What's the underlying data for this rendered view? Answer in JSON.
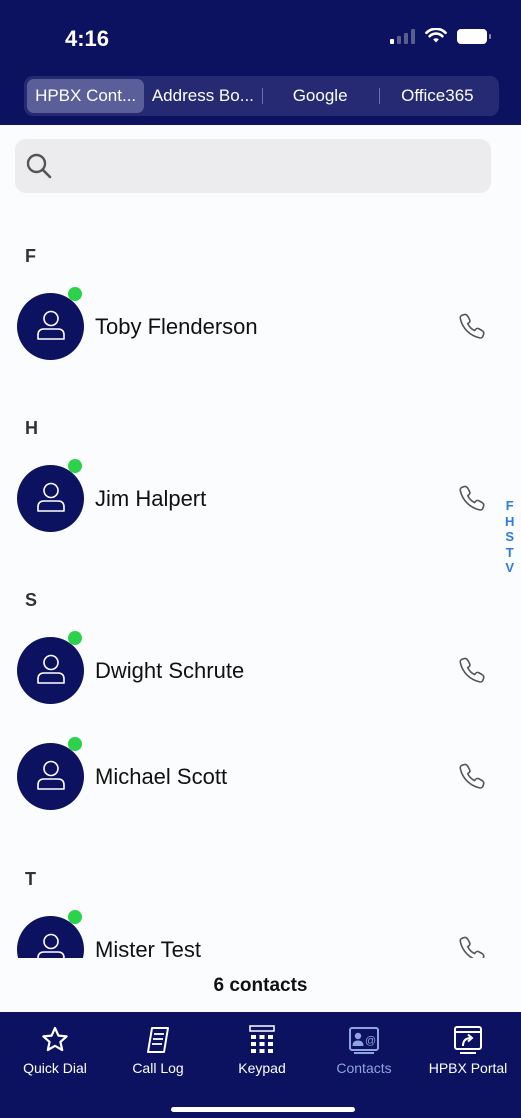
{
  "status_bar": {
    "time": "4:16"
  },
  "source_tabs": [
    {
      "label": "HPBX Cont...",
      "active": true
    },
    {
      "label": "Address Bo...",
      "active": false
    },
    {
      "label": "Google",
      "active": false
    },
    {
      "label": "Office365",
      "active": false
    }
  ],
  "search": {
    "placeholder": "",
    "value": "",
    "icon": "search-icon"
  },
  "sections": [
    {
      "letter": "F",
      "contacts": [
        {
          "name": "Toby Flenderson",
          "online": true
        }
      ]
    },
    {
      "letter": "H",
      "contacts": [
        {
          "name": "Jim Halpert",
          "online": true
        }
      ]
    },
    {
      "letter": "S",
      "contacts": [
        {
          "name": "Dwight Schrute",
          "online": true
        },
        {
          "name": "Michael Scott",
          "online": true
        }
      ]
    },
    {
      "letter": "T",
      "contacts": [
        {
          "name": "Mister Test",
          "online": true
        }
      ]
    }
  ],
  "index_letters": [
    "F",
    "H",
    "S",
    "T",
    "V"
  ],
  "contact_count": "6 contacts",
  "tab_bar": [
    {
      "label": "Quick Dial",
      "icon": "star-icon",
      "active": false
    },
    {
      "label": "Call Log",
      "icon": "call-log-icon",
      "active": false
    },
    {
      "label": "Keypad",
      "icon": "keypad-icon",
      "active": false
    },
    {
      "label": "Contacts",
      "icon": "contacts-icon",
      "active": true
    },
    {
      "label": "HPBX Portal",
      "icon": "portal-icon",
      "active": false
    }
  ],
  "colors": {
    "brand": "#0c1160",
    "presence": "#2bd24a",
    "index": "#2d7be0",
    "active_tab": "#8ea4e0"
  }
}
